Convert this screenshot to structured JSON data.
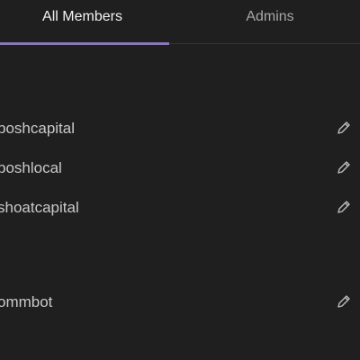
{
  "tabs": {
    "all_members": "All Members",
    "admins": "Admins"
  },
  "members": [
    {
      "name": "boshcapital"
    },
    {
      "name": "boshlocal"
    },
    {
      "name": "shoatcapital"
    },
    {
      "name": "ommbot"
    }
  ],
  "colors": {
    "background": "#1f1f1f",
    "accent": "#8a78b8",
    "text": "#c9c9c9"
  },
  "icons": {
    "edit": "pencil-icon"
  }
}
